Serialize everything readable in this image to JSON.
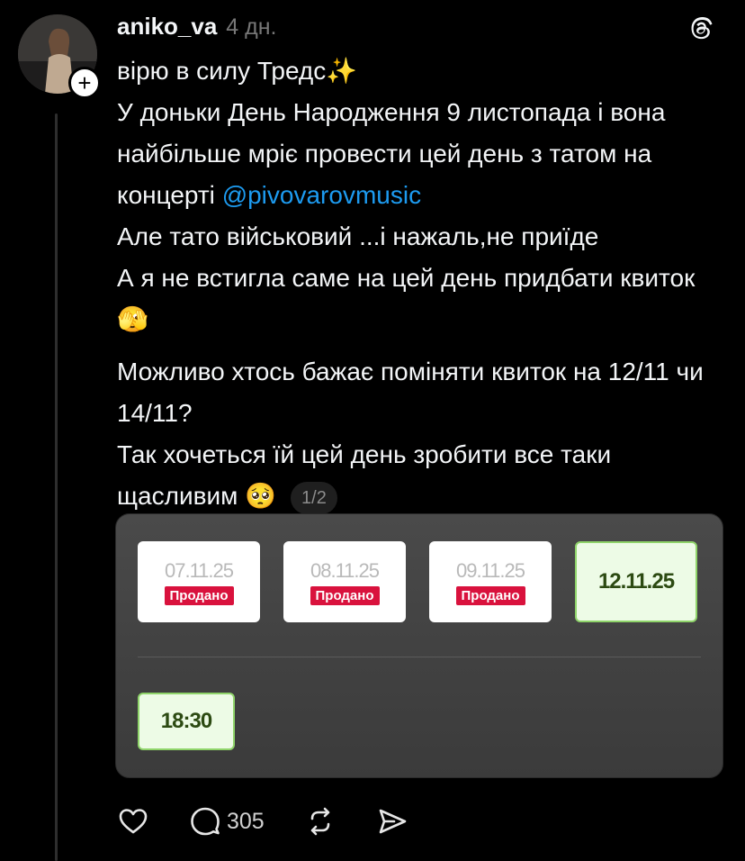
{
  "post": {
    "username": "aniko_va",
    "time": "4 дн.",
    "lines": {
      "l1": "вірю в силу Тредс",
      "l1_emoji": "✨",
      "l2": "У  доньки День Народження 9 листопада і вона найбільше мріє провести цей день з татом на концерті  ",
      "mention": "@pivovarovmusic",
      "l3": "Але тато військовий ...і нажаль,не приїде",
      "l4": "А я  не встигла саме на цей день придбати квиток ",
      "l4_emoji": "🫣",
      "l5": "Можливо хтось бажає поміняти квиток на 12/11 чи 14/11?",
      "l6": "Так хочеться їй цей день зробити все таки щасливим ",
      "l6_emoji": "🥺",
      "counter": "1/2"
    },
    "follow_symbol": "+"
  },
  "media": {
    "dates": [
      {
        "date": "07.11.25",
        "status": "Продано"
      },
      {
        "date": "08.11.25",
        "status": "Продано"
      },
      {
        "date": "09.11.25",
        "status": "Продано"
      },
      {
        "date": "12.11.25",
        "status": ""
      }
    ],
    "time": "18:30"
  },
  "actions": {
    "replies_count": "305"
  },
  "icons": {
    "like": "heart-icon",
    "reply": "comment-icon",
    "repost": "repost-icon",
    "share": "share-icon",
    "logo": "threads-logo-icon"
  },
  "colors": {
    "mention": "#1d9bf0",
    "sold_badge": "#d9123d",
    "selected_border": "#8fd46a"
  }
}
